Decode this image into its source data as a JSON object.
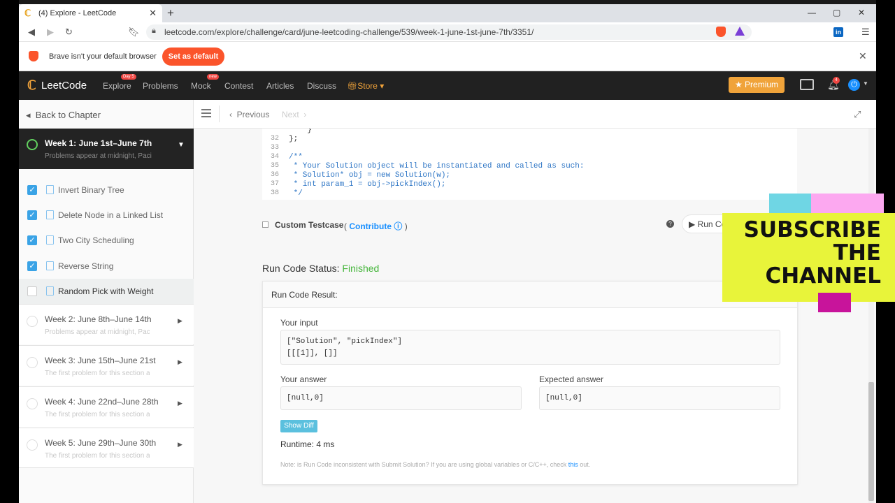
{
  "browser": {
    "tab_title": "(4) Explore - LeetCode",
    "url": "leetcode.com/explore/challenge/card/june-leetcoding-challenge/539/week-1-june-1st-june-7th/3351/",
    "brave_badge": "2",
    "ext_badge": "7"
  },
  "infobar": {
    "message": "Brave isn't your default browser",
    "button": "Set as default"
  },
  "nav": {
    "logo": "LeetCode",
    "explore": "Explore",
    "explore_badge": "Day 5",
    "problems": "Problems",
    "mock": "Mock",
    "mock_badge": "new",
    "contest": "Contest",
    "articles": "Articles",
    "discuss": "Discuss",
    "store": "Store",
    "premium": "Premium",
    "notifications": "4"
  },
  "sidebar": {
    "back": "Back to Chapter",
    "active_week": {
      "title": "Week 1: June 1st–June 7th",
      "subtitle": "Problems appear at midnight, Paci"
    },
    "problems": [
      {
        "label": "Invert Binary Tree",
        "done": true
      },
      {
        "label": "Delete Node in a Linked List",
        "done": true
      },
      {
        "label": "Two City Scheduling",
        "done": true
      },
      {
        "label": "Reverse String",
        "done": true
      },
      {
        "label": "Random Pick with Weight",
        "done": false
      }
    ],
    "weeks": [
      {
        "title": "Week 2: June 8th–June 14th",
        "subtitle": "Problems appear at midnight, Paci"
      },
      {
        "title": "Week 3: June 15th–June 21st",
        "subtitle": "The first problem for this section a"
      },
      {
        "title": "Week 4: June 22nd–June 28th",
        "subtitle": "The first problem for this section a"
      },
      {
        "title": "Week 5: June 29th–June 30th",
        "subtitle": "The first problem for this section a"
      }
    ]
  },
  "toolbar": {
    "previous": "Previous",
    "next": "Next"
  },
  "code": [
    {
      "ln": "32",
      "text": "};",
      "comment": false
    },
    {
      "ln": "33",
      "text": "",
      "comment": false
    },
    {
      "ln": "34",
      "text": "/**",
      "comment": true
    },
    {
      "ln": "35",
      "text": " * Your Solution object will be instantiated and called as such:",
      "comment": true
    },
    {
      "ln": "36",
      "text": " * Solution* obj = new Solution(w);",
      "comment": true
    },
    {
      "ln": "37",
      "text": " * int param_1 = obj->pickIndex();",
      "comment": true
    },
    {
      "ln": "38",
      "text": " */",
      "comment": true
    }
  ],
  "testcase": {
    "label": "Custom Testcase",
    "contribute": "Contribute",
    "run": "Run Co"
  },
  "result": {
    "status_label": "Run Code Status:",
    "status_value": "Finished",
    "header": "Run Code Result:",
    "input_label": "Your input",
    "input_value": "[\"Solution\", \"pickIndex\"]\n[[[1]], []]",
    "answer_label": "Your answer",
    "answer_value": "[null,0]",
    "expected_label": "Expected answer",
    "expected_value": "[null,0]",
    "show_diff": "Show Diff",
    "runtime": "Runtime: 4 ms",
    "note_prefix": "Note: is Run Code inconsistent with Submit Solution? If you are using global variables or C/C++, check ",
    "note_link": "this",
    "note_suffix": " out."
  },
  "overlay": {
    "line1": "SUBSCRIBE",
    "line2": "THE",
    "line3": "CHANNEL"
  },
  "colors": {
    "accent_orange": "#f0a33a",
    "brave_orange": "#fb542b",
    "finished_green": "#44b53a",
    "link_blue": "#1a90ff"
  }
}
